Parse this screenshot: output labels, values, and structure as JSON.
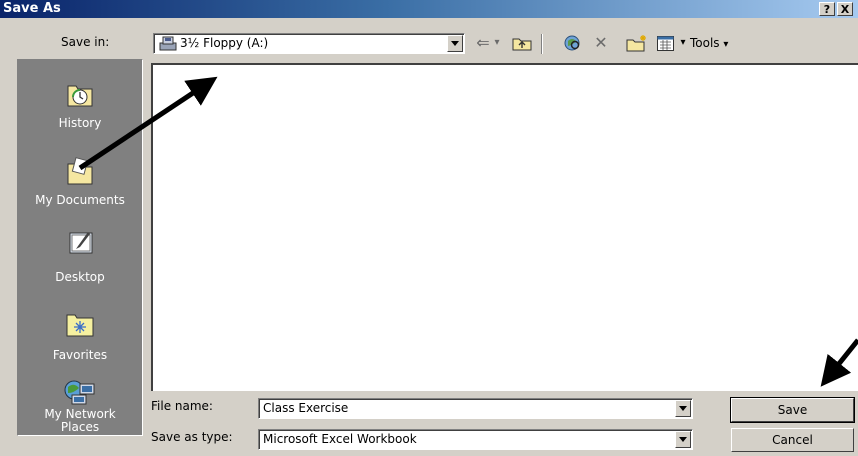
{
  "window": {
    "title": "Save As",
    "help_label": "?",
    "close_label": "X"
  },
  "toolbar": {
    "save_in_label": "Save in:",
    "location_value": "3½ Floppy (A:)",
    "back_glyph": "⇐",
    "up_glyph": "↥",
    "search_glyph": "◎",
    "delete_glyph": "✕",
    "new_folder_glyph": "✱",
    "views_glyph": "▦",
    "dropdown_glyph": "▾",
    "tools_label": "Tools"
  },
  "places": [
    {
      "label": "History",
      "icon": "history-icon"
    },
    {
      "label": "My Documents",
      "icon": "my-documents-icon"
    },
    {
      "label": "Desktop",
      "icon": "desktop-icon"
    },
    {
      "label": "Favorites",
      "icon": "favorites-icon"
    },
    {
      "label_line1": "My Network",
      "label_line2": "Places",
      "icon": "network-places-icon"
    }
  ],
  "form": {
    "file_name_label": "File name:",
    "file_name_value": "Class Exercise",
    "save_type_label": "Save as type:",
    "save_type_value": "Microsoft Excel Workbook"
  },
  "buttons": {
    "save_label": "Save",
    "cancel_label": "Cancel"
  },
  "colors": {
    "title_bar": "#0a246a",
    "dialog_face": "#d4d0c8",
    "places_bar": "#808080"
  }
}
